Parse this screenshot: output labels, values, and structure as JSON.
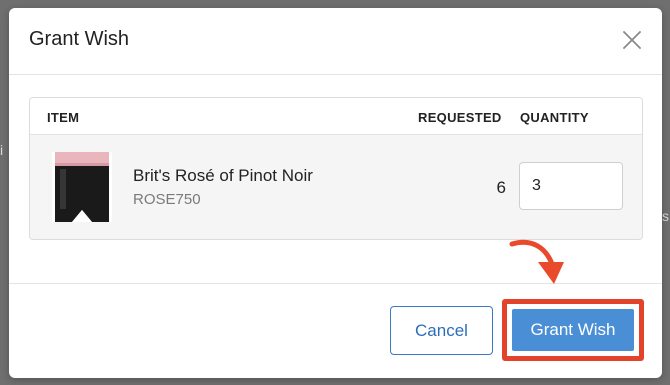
{
  "modal": {
    "title": "Grant Wish"
  },
  "table": {
    "headers": {
      "item": "ITEM",
      "requested": "REQUESTED",
      "quantity": "QUANTITY"
    },
    "rows": [
      {
        "name": "Brit's Rosé of Pinot Noir",
        "sku": "ROSE750",
        "requested": "6",
        "quantity": "3"
      }
    ]
  },
  "footer": {
    "cancel_label": "Cancel",
    "grant_label": "Grant Wish"
  },
  "colors": {
    "primary": "#4a8fd6",
    "highlight": "#e2432a",
    "annotation_arrow": "#ea4a2c"
  },
  "icons": {
    "close": "close-icon",
    "annotation": "curved-arrow-icon"
  }
}
